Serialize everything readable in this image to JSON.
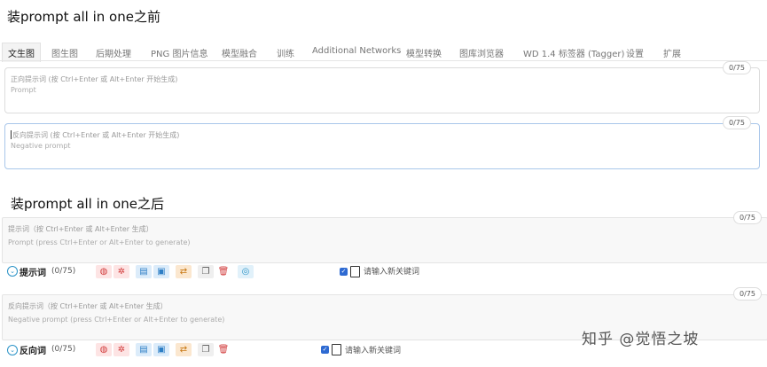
{
  "before": {
    "heading": "装prompt all in one之前",
    "tabs": [
      "文生图",
      "图生图",
      "后期处理",
      "PNG 图片信息",
      "模型融合",
      "训练",
      "Additional Networks",
      "模型转换",
      "图库浏览器",
      "WD 1.4 标签器 (Tagger)",
      "设置",
      "扩展"
    ],
    "positive": {
      "counter": "0/75",
      "placeholder_line1": "正向提示词 (按 Ctrl+Enter 或 Alt+Enter 开始生成)",
      "placeholder_line2": "Prompt"
    },
    "negative": {
      "counter": "0/75",
      "placeholder_line1": "反向提示词 (按 Ctrl+Enter 或 Alt+Enter 开始生成)",
      "placeholder_line2": "Negative prompt"
    }
  },
  "after": {
    "heading": "装prompt all in one之后",
    "positive": {
      "counter": "0/75",
      "placeholder_line1": "提示词（按 Ctrl+Enter 或 Alt+Enter 生成）",
      "placeholder_line2": "Prompt (press Ctrl+Enter or Alt+Enter to generate)",
      "label": "提示词",
      "count": "(0/75)",
      "keyword_placeholder": "请输入新关键词"
    },
    "negative": {
      "counter": "0/75",
      "placeholder_line1": "反向提示词（按 Ctrl+Enter 或 Alt+Enter 生成）",
      "placeholder_line2": "Negative prompt (press Ctrl+Enter or Alt+Enter to generate)",
      "label": "反向词",
      "count": "(0/75)",
      "keyword_placeholder": "请输入新关键词"
    },
    "toolbar_icons": [
      "globe-icon",
      "settings-icon",
      "import-icon",
      "bookmark-icon",
      "translate-icon",
      "copy-icon",
      "trash-icon",
      "web-icon"
    ]
  },
  "watermark": "知乎 @觉悟之坡",
  "colors": {
    "accent": "#2e6ad2",
    "focus_border": "#a9c7ea",
    "pink_button": "#fde4e4",
    "blue_button": "#dcecfa",
    "orange_button": "#fbe7cf"
  }
}
